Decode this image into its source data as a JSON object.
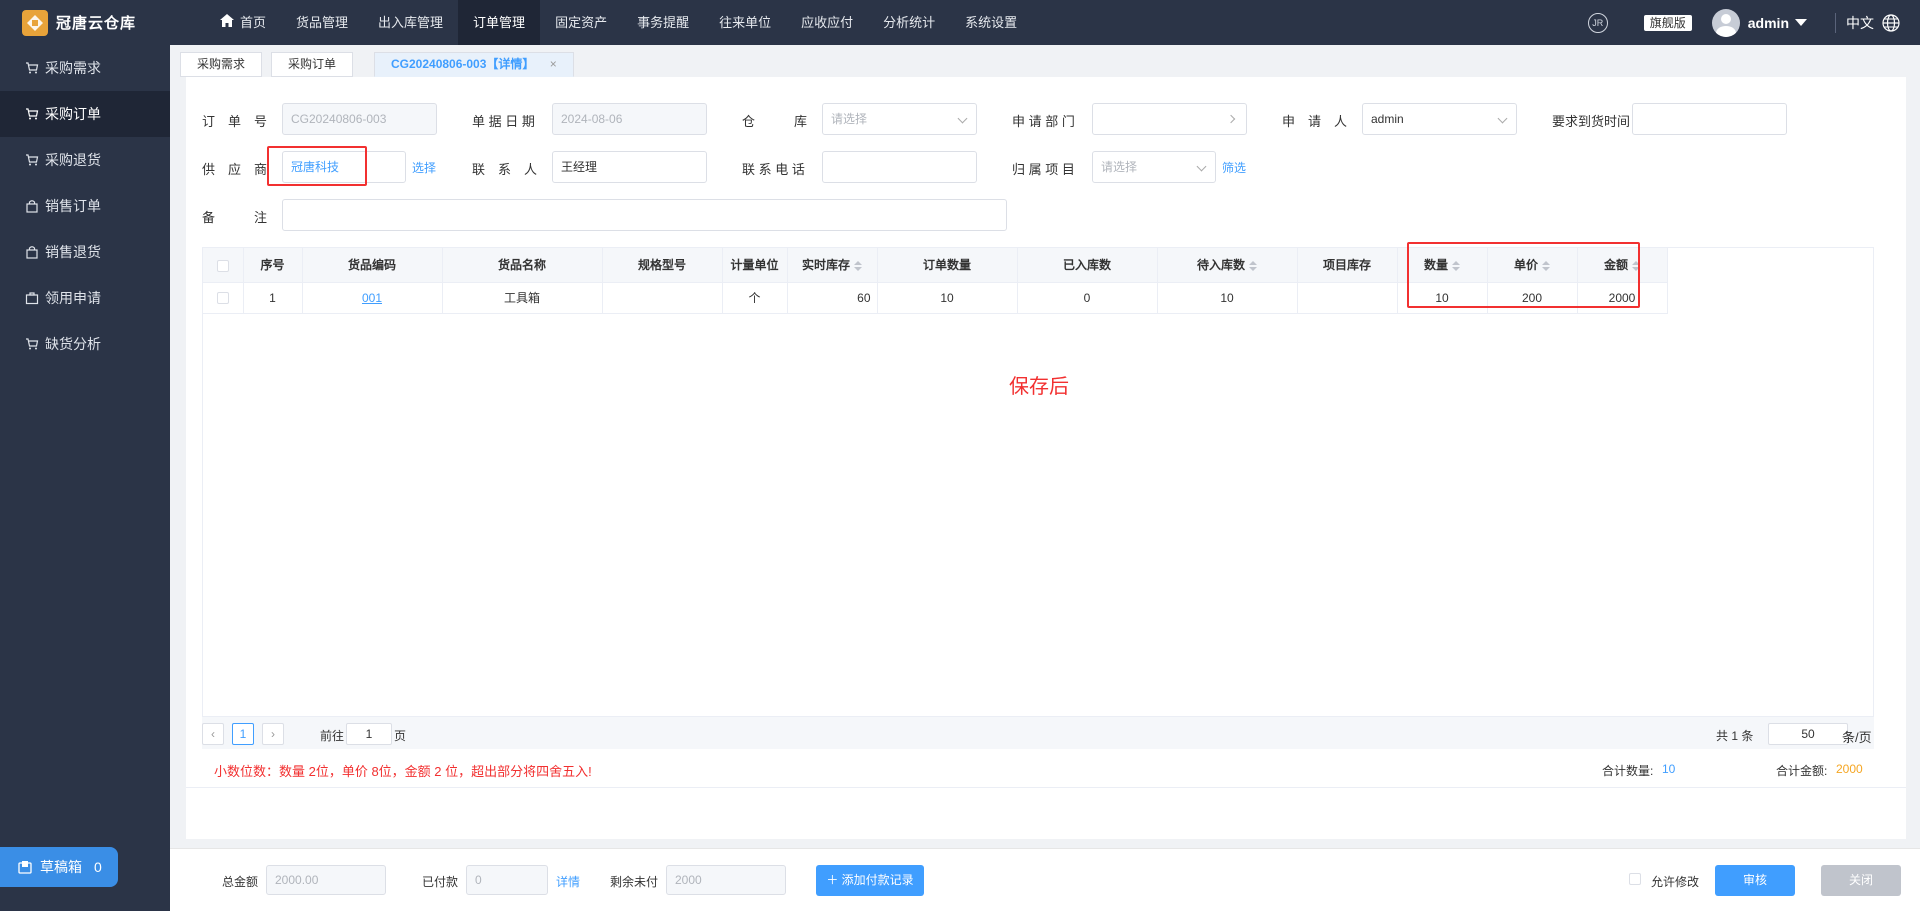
{
  "app": {
    "brand": "冠唐云仓库"
  },
  "nav": {
    "home": "首页",
    "items": [
      "货品管理",
      "出入库管理",
      "订单管理",
      "固定资产",
      "事务提醒",
      "往来单位",
      "应收应付",
      "分析统计",
      "系统设置"
    ],
    "active_index": 2
  },
  "topright": {
    "edition": "旗舰版",
    "user": "admin",
    "lang": "中文"
  },
  "sidebar": {
    "items": [
      "采购需求",
      "采购订单",
      "采购退货",
      "销售订单",
      "销售退货",
      "领用申请",
      "缺货分析"
    ],
    "active_index": 1,
    "draft_label": "草稿箱",
    "draft_count": "0"
  },
  "tabs": {
    "items": [
      "采购需求",
      "采购订单",
      "CG20240806-003【详情】"
    ],
    "close": "×"
  },
  "form": {
    "order_no_label": "订　单　号",
    "order_no": "CG20240806-003",
    "doc_date_label": "单 据 日 期",
    "doc_date": "2024-08-06",
    "warehouse_label": "仓　　　库",
    "warehouse_placeholder": "请选择",
    "dept_label": "申 请 部 门",
    "dept_value": "",
    "applicant_label": "申　请　人",
    "applicant": "admin",
    "arrival_label": "要求到货时间",
    "arrival_value": "",
    "supplier_label": "供　应　商",
    "supplier": "冠唐科技",
    "supplier_select": "选择",
    "contact_label": "联　系　人",
    "contact": "王经理",
    "phone_label": "联 系 电 话",
    "phone": "",
    "project_label": "归 属 项 目",
    "project_placeholder": "请选择",
    "project_filter": "筛选",
    "remark_label": "备　　　注",
    "remark": ""
  },
  "table": {
    "headers": [
      "序号",
      "货品编码",
      "货品名称",
      "规格型号",
      "计量单位",
      "实时库存",
      "订单数量",
      "已入库数",
      "待入库数",
      "项目库存",
      "数量",
      "单价",
      "金额"
    ],
    "rows": [
      {
        "seq": "1",
        "code": "001",
        "name": "工具箱",
        "spec": "",
        "unit": "个",
        "stock": "60",
        "order_qty": "10",
        "received": "0",
        "pending": "10",
        "project_stock": "",
        "qty": "10",
        "price": "200",
        "amount": "2000"
      }
    ],
    "annotation": "保存后"
  },
  "pager": {
    "current": "1",
    "goto_prefix": "前往",
    "goto_value": "1",
    "goto_suffix": "页",
    "total": "共 1 条",
    "page_size": "50",
    "page_size_suffix": "条/页"
  },
  "summary": {
    "decimal_note": "小数位数：数量 2位，单价 8位，金额 2 位，超出部分将四舍五入!",
    "total_qty_label": "合计数量:",
    "total_qty": "10",
    "total_amount_label": "合计金额:",
    "total_amount": "2000"
  },
  "footer": {
    "total_label": "总金额",
    "total": "2000.00",
    "paid_label": "已付款",
    "paid": "0",
    "detail_link": "详情",
    "unpaid_label": "剩余未付",
    "unpaid": "2000",
    "add_payment": "添加付款记录",
    "allow_edit": "允许修改",
    "approve": "审核",
    "close": "关闭"
  },
  "colors": {
    "accent": "#409eff",
    "header_bg": "#2b3447",
    "highlight": "#f23030",
    "amount_orange": "#f5a623"
  }
}
